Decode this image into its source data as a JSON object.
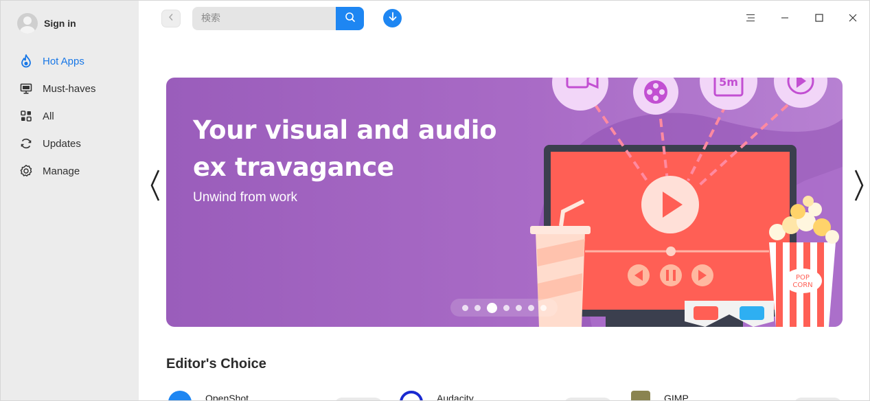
{
  "sidebar": {
    "signin_label": "Sign in",
    "items": [
      {
        "label": "Hot Apps",
        "icon": "flame-icon",
        "active": true
      },
      {
        "label": "Must-haves",
        "icon": "monitor-icon",
        "active": false
      },
      {
        "label": "All",
        "icon": "grid-icon",
        "active": false
      },
      {
        "label": "Updates",
        "icon": "refresh-icon",
        "active": false
      },
      {
        "label": "Manage",
        "icon": "gear-icon",
        "active": false
      }
    ]
  },
  "toolbar": {
    "search_placeholder": "検索",
    "search_value": ""
  },
  "banner": {
    "title": "Your visual and audio ex travagance",
    "subtitle": "Unwind from work",
    "popcorn_label": "POP CORN",
    "duration_label": "5m",
    "dots_count": 7,
    "active_dot_index": 2
  },
  "editors_choice": {
    "title": "Editor's Choice",
    "apps": [
      {
        "name": "OpenShot"
      },
      {
        "name": "Audacity"
      },
      {
        "name": "GIMP"
      }
    ]
  },
  "colors": {
    "accent": "#1e86f2",
    "sidebar_bg": "#ececec",
    "banner_start": "#9a5dbb",
    "banner_end": "#b781d2"
  }
}
